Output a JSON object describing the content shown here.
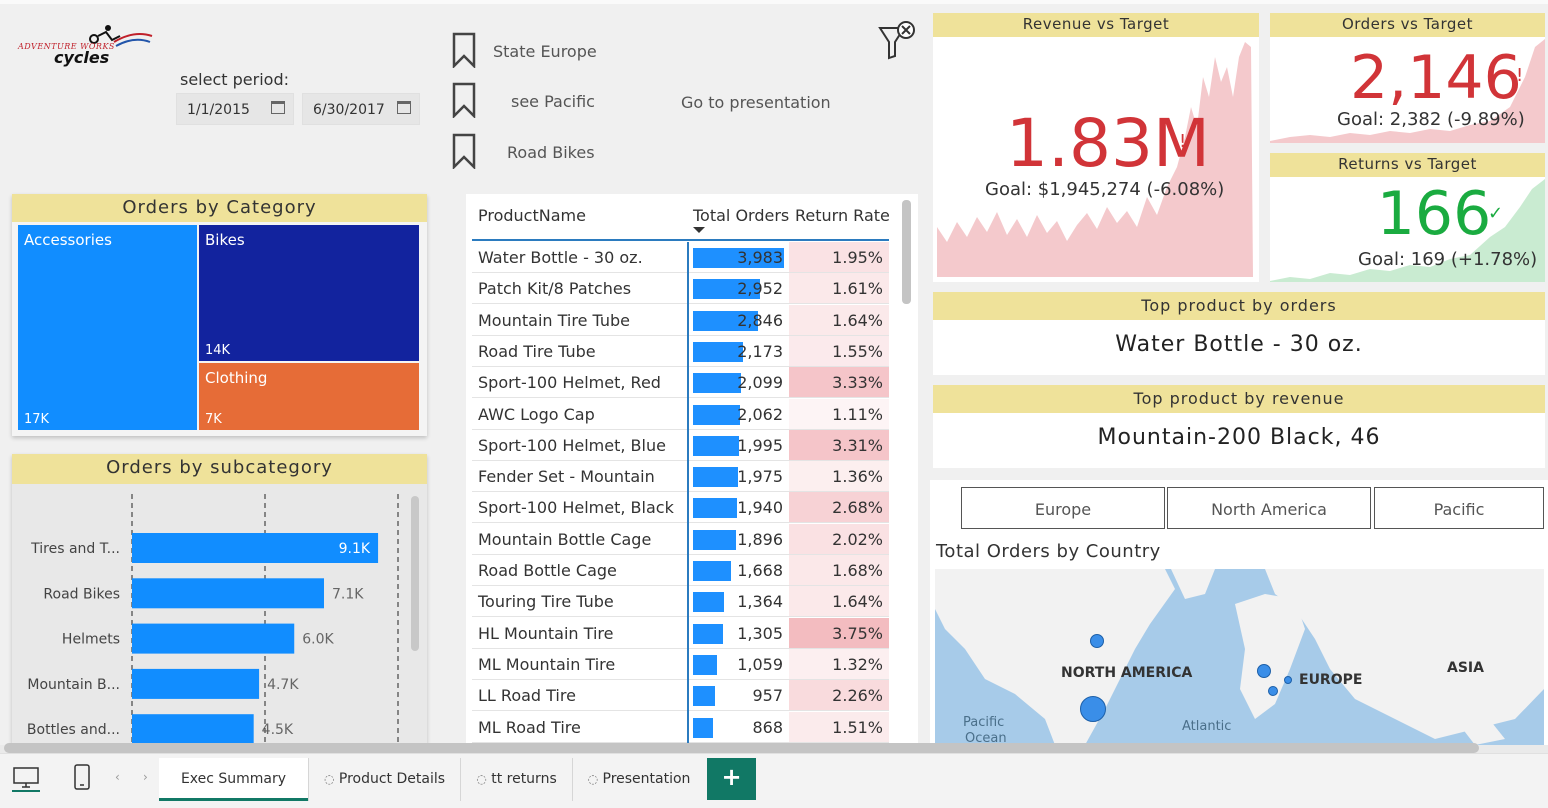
{
  "logo": {
    "line1": "ADVENTURE WORKS",
    "line2": "cycles"
  },
  "period": {
    "label": "select period:",
    "start": "1/1/2015",
    "end": "6/30/2017"
  },
  "bookmarks": [
    {
      "label": "State Europe"
    },
    {
      "label": "see Pacific"
    },
    {
      "label": "Road Bikes"
    }
  ],
  "goto_presentation": "Go to presentation",
  "orders_by_category": {
    "title": "Orders by Category",
    "tiles": [
      {
        "name": "Accessories",
        "value": "17K",
        "color": "#118dff"
      },
      {
        "name": "Bikes",
        "value": "14K",
        "color": "#12239e"
      },
      {
        "name": "Clothing",
        "value": "7K",
        "color": "#e66c37"
      }
    ]
  },
  "orders_by_subcategory": {
    "title": "Orders by subcategory",
    "bar_color": "#118dff"
  },
  "chart_data": {
    "type": "bar",
    "orientation": "horizontal",
    "title": "Orders by subcategory",
    "categories": [
      "Tires and T...",
      "Road Bikes",
      "Helmets",
      "Mountain B...",
      "Bottles and..."
    ],
    "values": [
      9100,
      7100,
      6000,
      4700,
      4500
    ],
    "data_labels": [
      "9.1K",
      "7.1K",
      "6.0K",
      "4.7K",
      "4.5K"
    ],
    "xlim": [
      0,
      9800
    ]
  },
  "product_table": {
    "columns": [
      "ProductName",
      "Total Orders",
      "Return Rate"
    ],
    "max_orders": 3983,
    "rows": [
      {
        "name": "Water Bottle - 30 oz.",
        "orders": "3,983",
        "orders_num": 3983,
        "rate": "1.95%",
        "rate_num": 1.95
      },
      {
        "name": "Patch Kit/8 Patches",
        "orders": "2,952",
        "orders_num": 2952,
        "rate": "1.61%",
        "rate_num": 1.61
      },
      {
        "name": "Mountain Tire Tube",
        "orders": "2,846",
        "orders_num": 2846,
        "rate": "1.64%",
        "rate_num": 1.64
      },
      {
        "name": "Road Tire Tube",
        "orders": "2,173",
        "orders_num": 2173,
        "rate": "1.55%",
        "rate_num": 1.55
      },
      {
        "name": "Sport-100 Helmet, Red",
        "orders": "2,099",
        "orders_num": 2099,
        "rate": "3.33%",
        "rate_num": 3.33
      },
      {
        "name": "AWC Logo Cap",
        "orders": "2,062",
        "orders_num": 2062,
        "rate": "1.11%",
        "rate_num": 1.11
      },
      {
        "name": "Sport-100 Helmet, Blue",
        "orders": "1,995",
        "orders_num": 1995,
        "rate": "3.31%",
        "rate_num": 3.31
      },
      {
        "name": "Fender Set - Mountain",
        "orders": "1,975",
        "orders_num": 1975,
        "rate": "1.36%",
        "rate_num": 1.36
      },
      {
        "name": "Sport-100 Helmet, Black",
        "orders": "1,940",
        "orders_num": 1940,
        "rate": "2.68%",
        "rate_num": 2.68
      },
      {
        "name": "Mountain Bottle Cage",
        "orders": "1,896",
        "orders_num": 1896,
        "rate": "2.02%",
        "rate_num": 2.02
      },
      {
        "name": "Road Bottle Cage",
        "orders": "1,668",
        "orders_num": 1668,
        "rate": "1.68%",
        "rate_num": 1.68
      },
      {
        "name": "Touring Tire Tube",
        "orders": "1,364",
        "orders_num": 1364,
        "rate": "1.64%",
        "rate_num": 1.64
      },
      {
        "name": "HL Mountain Tire",
        "orders": "1,305",
        "orders_num": 1305,
        "rate": "3.75%",
        "rate_num": 3.75
      },
      {
        "name": "ML Mountain Tire",
        "orders": "1,059",
        "orders_num": 1059,
        "rate": "1.32%",
        "rate_num": 1.32
      },
      {
        "name": "LL Road Tire",
        "orders": "957",
        "orders_num": 957,
        "rate": "2.26%",
        "rate_num": 2.26
      },
      {
        "name": "ML Road Tire",
        "orders": "868",
        "orders_num": 868,
        "rate": "1.51%",
        "rate_num": 1.51
      }
    ]
  },
  "kpis": {
    "revenue": {
      "title": "Revenue vs Target",
      "value": "1.83M",
      "flag": "!",
      "goal": "Goal: $1,945,274 (-6.08%)",
      "color": "#d13438"
    },
    "orders": {
      "title": "Orders vs Target",
      "value": "2,146",
      "flag": "!",
      "goal": "Goal: 2,382 (-9.89%)",
      "color": "#d13438"
    },
    "returns": {
      "title": "Returns vs Target",
      "value": "166",
      "flag": "✓",
      "goal": "Goal: 169 (+1.78%)",
      "color": "#1aab40"
    }
  },
  "top_product_orders": {
    "title": "Top product by orders",
    "value": "Water Bottle - 30 oz."
  },
  "top_product_revenue": {
    "title": "Top product by revenue",
    "value": "Mountain-200 Black, 46"
  },
  "region_slicer": [
    "Europe",
    "North America",
    "Pacific"
  ],
  "map": {
    "title": "Total Orders by Country",
    "labels": [
      "NORTH AMERICA",
      "EUROPE",
      "ASIA"
    ],
    "ocean_labels": [
      "Pacific",
      "Ocean",
      "Atlantic"
    ]
  },
  "tabs": [
    {
      "label": "Exec Summary",
      "active": true,
      "hidden_icon": false
    },
    {
      "label": "Product Details",
      "active": false,
      "hidden_icon": true
    },
    {
      "label": "tt returns",
      "active": false,
      "hidden_icon": true
    },
    {
      "label": "Presentation",
      "active": false,
      "hidden_icon": true
    }
  ],
  "add_tab_label": "+"
}
